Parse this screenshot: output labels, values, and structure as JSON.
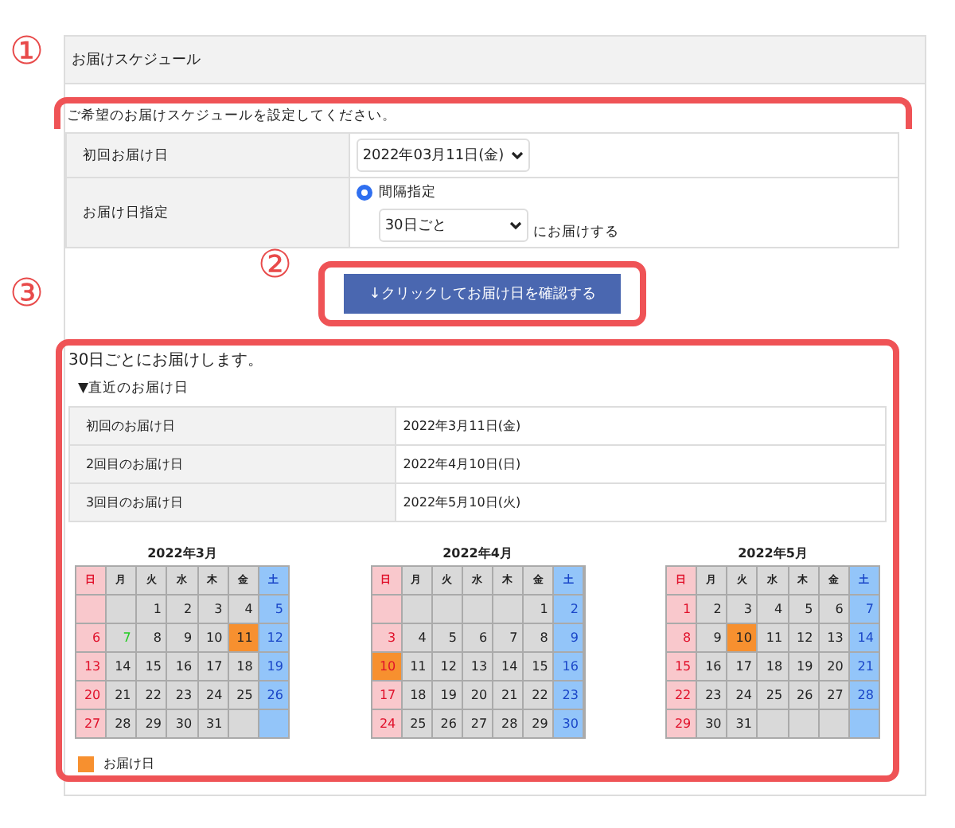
{
  "panel": {
    "title": "お届けスケジュール"
  },
  "annotations": [
    {
      "label": "①"
    },
    {
      "label": "②"
    },
    {
      "label": "③"
    }
  ],
  "settings": {
    "intro": "ご希望のお届けスケジュールを設定してください。",
    "first_label": "初回お届け日",
    "first_value": "2022年03月11日(金)",
    "interval_label": "お届け日指定",
    "radio": {
      "label": "間隔指定",
      "selected": true
    },
    "interval_value": "30日ごと",
    "interval_suffix": "にお届けする"
  },
  "confirm_button": "↓クリックしてお届け日を確認する",
  "result": {
    "summary": "30日ごとにお届けします。",
    "subheading": "▼直近のお届け日",
    "rows": [
      {
        "label": "初回のお届け日",
        "value": "2022年3月11日(金)"
      },
      {
        "label": "2回目のお届け日",
        "value": "2022年4月10日(日)"
      },
      {
        "label": "3回目のお届け日",
        "value": "2022年5月10日(火)"
      }
    ],
    "months": [
      {
        "title": "2022年3月",
        "weekdays": [
          "日",
          "月",
          "火",
          "水",
          "木",
          "金",
          "土"
        ],
        "weeks": [
          [
            {
              "kind": "empty"
            },
            {
              "kind": "empty"
            },
            {
              "kind": "day",
              "day": "1",
              "delivery": false
            },
            {
              "kind": "day",
              "day": "2",
              "delivery": false
            },
            {
              "kind": "day",
              "day": "3",
              "delivery": false
            },
            {
              "kind": "day",
              "day": "4",
              "delivery": false
            },
            {
              "kind": "day",
              "day": "5",
              "delivery": false
            }
          ],
          [
            {
              "kind": "day",
              "day": "6",
              "delivery": false
            },
            {
              "kind": "day",
              "day": "7",
              "delivery": false,
              "color": "#22cc22"
            },
            {
              "kind": "day",
              "day": "8",
              "delivery": false
            },
            {
              "kind": "day",
              "day": "9",
              "delivery": false
            },
            {
              "kind": "day",
              "day": "10",
              "delivery": false
            },
            {
              "kind": "day",
              "day": "11",
              "delivery": true
            },
            {
              "kind": "day",
              "day": "12",
              "delivery": false
            }
          ],
          [
            {
              "kind": "day",
              "day": "13",
              "delivery": false
            },
            {
              "kind": "day",
              "day": "14",
              "delivery": false
            },
            {
              "kind": "day",
              "day": "15",
              "delivery": false
            },
            {
              "kind": "day",
              "day": "16",
              "delivery": false
            },
            {
              "kind": "day",
              "day": "17",
              "delivery": false
            },
            {
              "kind": "day",
              "day": "18",
              "delivery": false
            },
            {
              "kind": "day",
              "day": "19",
              "delivery": false
            }
          ],
          [
            {
              "kind": "day",
              "day": "20",
              "delivery": false
            },
            {
              "kind": "day",
              "day": "21",
              "delivery": false
            },
            {
              "kind": "day",
              "day": "22",
              "delivery": false
            },
            {
              "kind": "day",
              "day": "23",
              "delivery": false
            },
            {
              "kind": "day",
              "day": "24",
              "delivery": false
            },
            {
              "kind": "day",
              "day": "25",
              "delivery": false
            },
            {
              "kind": "day",
              "day": "26",
              "delivery": false
            }
          ],
          [
            {
              "kind": "day",
              "day": "27",
              "delivery": false
            },
            {
              "kind": "day",
              "day": "28",
              "delivery": false
            },
            {
              "kind": "day",
              "day": "29",
              "delivery": false
            },
            {
              "kind": "day",
              "day": "30",
              "delivery": false
            },
            {
              "kind": "day",
              "day": "31",
              "delivery": false
            },
            {
              "kind": "empty"
            },
            {
              "kind": "empty"
            }
          ]
        ]
      },
      {
        "title": "2022年4月",
        "weekdays": [
          "日",
          "月",
          "火",
          "水",
          "木",
          "金",
          "土"
        ],
        "weeks": [
          [
            {
              "kind": "empty"
            },
            {
              "kind": "empty"
            },
            {
              "kind": "empty"
            },
            {
              "kind": "empty"
            },
            {
              "kind": "empty"
            },
            {
              "kind": "day",
              "day": "1",
              "delivery": false
            },
            {
              "kind": "day",
              "day": "2",
              "delivery": false
            }
          ],
          [
            {
              "kind": "day",
              "day": "3",
              "delivery": false
            },
            {
              "kind": "day",
              "day": "4",
              "delivery": false
            },
            {
              "kind": "day",
              "day": "5",
              "delivery": false
            },
            {
              "kind": "day",
              "day": "6",
              "delivery": false
            },
            {
              "kind": "day",
              "day": "7",
              "delivery": false
            },
            {
              "kind": "day",
              "day": "8",
              "delivery": false
            },
            {
              "kind": "day",
              "day": "9",
              "delivery": false
            }
          ],
          [
            {
              "kind": "day",
              "day": "10",
              "delivery": true
            },
            {
              "kind": "day",
              "day": "11",
              "delivery": false
            },
            {
              "kind": "day",
              "day": "12",
              "delivery": false
            },
            {
              "kind": "day",
              "day": "13",
              "delivery": false
            },
            {
              "kind": "day",
              "day": "14",
              "delivery": false
            },
            {
              "kind": "day",
              "day": "15",
              "delivery": false
            },
            {
              "kind": "day",
              "day": "16",
              "delivery": false
            }
          ],
          [
            {
              "kind": "day",
              "day": "17",
              "delivery": false
            },
            {
              "kind": "day",
              "day": "18",
              "delivery": false
            },
            {
              "kind": "day",
              "day": "19",
              "delivery": false
            },
            {
              "kind": "day",
              "day": "20",
              "delivery": false
            },
            {
              "kind": "day",
              "day": "21",
              "delivery": false
            },
            {
              "kind": "day",
              "day": "22",
              "delivery": false
            },
            {
              "kind": "day",
              "day": "23",
              "delivery": false
            }
          ],
          [
            {
              "kind": "day",
              "day": "24",
              "delivery": false
            },
            {
              "kind": "day",
              "day": "25",
              "delivery": false
            },
            {
              "kind": "day",
              "day": "26",
              "delivery": false
            },
            {
              "kind": "day",
              "day": "27",
              "delivery": false
            },
            {
              "kind": "day",
              "day": "28",
              "delivery": false
            },
            {
              "kind": "day",
              "day": "29",
              "delivery": false
            },
            {
              "kind": "day",
              "day": "30",
              "delivery": false
            }
          ]
        ]
      },
      {
        "title": "2022年5月",
        "weekdays": [
          "日",
          "月",
          "火",
          "水",
          "木",
          "金",
          "土"
        ],
        "weeks": [
          [
            {
              "kind": "day",
              "day": "1",
              "delivery": false
            },
            {
              "kind": "day",
              "day": "2",
              "delivery": false
            },
            {
              "kind": "day",
              "day": "3",
              "delivery": false
            },
            {
              "kind": "day",
              "day": "4",
              "delivery": false
            },
            {
              "kind": "day",
              "day": "5",
              "delivery": false
            },
            {
              "kind": "day",
              "day": "6",
              "delivery": false
            },
            {
              "kind": "day",
              "day": "7",
              "delivery": false
            }
          ],
          [
            {
              "kind": "day",
              "day": "8",
              "delivery": false
            },
            {
              "kind": "day",
              "day": "9",
              "delivery": false
            },
            {
              "kind": "day",
              "day": "10",
              "delivery": true
            },
            {
              "kind": "day",
              "day": "11",
              "delivery": false
            },
            {
              "kind": "day",
              "day": "12",
              "delivery": false
            },
            {
              "kind": "day",
              "day": "13",
              "delivery": false
            },
            {
              "kind": "day",
              "day": "14",
              "delivery": false
            }
          ],
          [
            {
              "kind": "day",
              "day": "15",
              "delivery": false
            },
            {
              "kind": "day",
              "day": "16",
              "delivery": false
            },
            {
              "kind": "day",
              "day": "17",
              "delivery": false
            },
            {
              "kind": "day",
              "day": "18",
              "delivery": false
            },
            {
              "kind": "day",
              "day": "19",
              "delivery": false
            },
            {
              "kind": "day",
              "day": "20",
              "delivery": false
            },
            {
              "kind": "day",
              "day": "21",
              "delivery": false
            }
          ],
          [
            {
              "kind": "day",
              "day": "22",
              "delivery": false
            },
            {
              "kind": "day",
              "day": "23",
              "delivery": false
            },
            {
              "kind": "day",
              "day": "24",
              "delivery": false
            },
            {
              "kind": "day",
              "day": "25",
              "delivery": false
            },
            {
              "kind": "day",
              "day": "26",
              "delivery": false
            },
            {
              "kind": "day",
              "day": "27",
              "delivery": false
            },
            {
              "kind": "day",
              "day": "28",
              "delivery": false
            }
          ],
          [
            {
              "kind": "day",
              "day": "29",
              "delivery": false
            },
            {
              "kind": "day",
              "day": "30",
              "delivery": false
            },
            {
              "kind": "day",
              "day": "31",
              "delivery": false
            },
            {
              "kind": "empty"
            },
            {
              "kind": "empty"
            },
            {
              "kind": "empty"
            },
            {
              "kind": "empty"
            }
          ]
        ]
      }
    ],
    "legend": "お届け日"
  }
}
